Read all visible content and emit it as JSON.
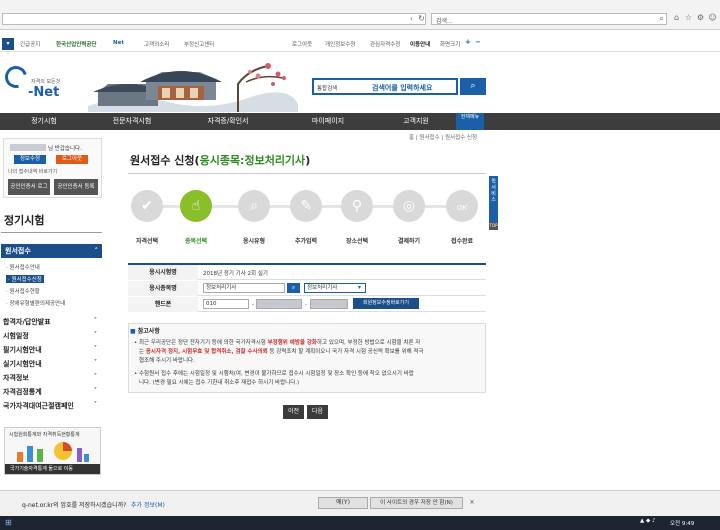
{
  "browser": {
    "search_placeholder": "검색...",
    "back_label": "‹",
    "refresh_label": "↻"
  },
  "utilbar": {
    "items": [
      "긴급공지",
      "한국산업인력공단",
      "Net",
      "고객의소리",
      "부정신고센터"
    ],
    "right_items": [
      "로그아웃",
      "개인정보수정",
      "관심자격수정",
      "이용안내",
      "화면크기"
    ],
    "zoom_plus": "+",
    "zoom_minus": "−"
  },
  "logo": {
    "tagline": "자격의 모든것",
    "name": "-Net"
  },
  "search": {
    "select_value": "통합검색",
    "placeholder": "검색어를 입력하세요"
  },
  "nav": {
    "items": [
      "정기시험",
      "전문자격시험",
      "자격증/확인서",
      "마이페이지",
      "고객지원"
    ],
    "all_menu": "전체메뉴"
  },
  "sidebar": {
    "greeting": "님 반갑습니다.",
    "btn_info": "정보수정",
    "btn_logout": "로그아웃",
    "recent": "나의 접수내역 바로가기",
    "cert_login": "공인인증서 로그인",
    "cert_register": "공인인증서 등록",
    "title": "정기시험",
    "active_menu": "원서접수",
    "sub_items": [
      "원서접수안내",
      "원서접수신청",
      "원서접수현황",
      "장애유형별편의제공안내"
    ],
    "categories": [
      "합격자/답안발표",
      "시험일정",
      "필기시험안내",
      "실기시험안내",
      "자격정보",
      "자격검정통계",
      "국가자격대여근절캠페인"
    ],
    "stats_title": "시험원회통계와 자격취득현황통계",
    "stats_link": "국가기술자격통계 둘으로 이동"
  },
  "main": {
    "breadcrumb": "홈 | 원서접수 | 원서접수 신청",
    "title_prefix": "원서접수 신청(",
    "title_highlight": "응시종목:정보처리기사",
    "title_suffix": ")",
    "steps": [
      "자격선택",
      "종목선택",
      "응시유형",
      "추가입력",
      "장소선택",
      "결제하기",
      "접수완료"
    ],
    "active_step": 1,
    "side_tab": "퀵서비스",
    "top_label": "TOP"
  },
  "form": {
    "rows": [
      {
        "label": "응시시험명",
        "value": "2018년 정기 기사 2회 실기"
      },
      {
        "label": "응시종목명",
        "value": "정보처리기사",
        "select": "정보처리기사"
      },
      {
        "label": "핸드폰",
        "value": "010"
      }
    ],
    "phone_button": "회원정보수정바로가기"
  },
  "notice": {
    "title": "참고사항",
    "line1_a": "최근 우리공단은 정단 전자기기 등에 의한 국가자격시험 ",
    "line1_red": "부정행위 예방을 강화",
    "line1_b": "하고 있으며, 부정한 방법으로 시험을 치른 자",
    "line2_a": "는 ",
    "line2_red": "응시자격 정지, 시험무효 및 합격취소, 검찰 수사의뢰",
    "line2_b": " 등 강력조치 할 계획이오니 국가 자격 시험 공신력 확보를 위해 적극",
    "line3": "협조해 주시기 바랍니다.",
    "line4": "수험원서 접수 후에는 시험일정 및 시행처(여, 변경이 불가하므로 접수시 시험일정 및 장소 확인 등에 착오 없으시기 바랍",
    "line5": "니다. (변경 필요 시에는 접수 기한내 취소후 재접수 하시기 바랍니다.)"
  },
  "buttons": {
    "prev": "이전",
    "next": "다음"
  },
  "download_bar": {
    "message": "q-net.or.kr의 암호를 저장하시겠습니까?",
    "more_info": "추가 정보(M)",
    "yes": "예(Y)",
    "never": "이 사이트의 경우 저장 안 함(N)"
  },
  "taskbar": {
    "clock": "오전 9:49"
  },
  "colors": {
    "brand_blue": "#1a5fa8",
    "nav_dark": "#3d3d3d",
    "active_green": "#8bbf2a",
    "title_green": "#2e8b20",
    "warning_red": "#d32b2b"
  }
}
